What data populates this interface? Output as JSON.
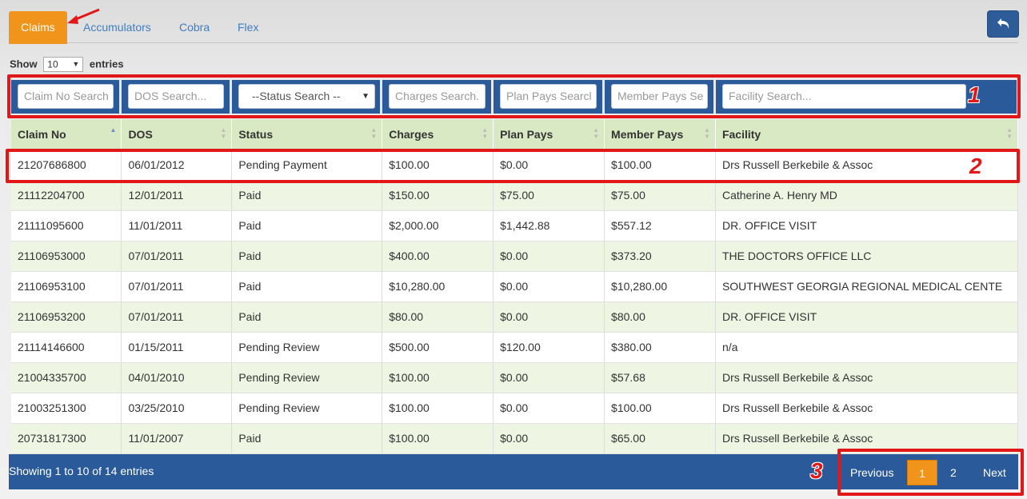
{
  "tabs": [
    {
      "label": "Claims",
      "active": true
    },
    {
      "label": "Accumulators"
    },
    {
      "label": "Cobra"
    },
    {
      "label": "Flex"
    }
  ],
  "show_entries": {
    "prefix": "Show",
    "value": "10",
    "suffix": "entries"
  },
  "filters": {
    "claim_no": "Claim No Search",
    "dos": "DOS Search...",
    "status": "--Status Search --",
    "charges": "Charges Search.",
    "plan_pays": "Plan Pays Searcl",
    "member_pays": "Member Pays Se",
    "facility": "Facility Search..."
  },
  "columns": [
    "Claim No",
    "DOS",
    "Status",
    "Charges",
    "Plan Pays",
    "Member Pays",
    "Facility"
  ],
  "rows": [
    [
      "21207686800",
      "06/01/2012",
      "Pending Payment",
      "$100.00",
      "$0.00",
      "$100.00",
      "Drs Russell Berkebile & Assoc"
    ],
    [
      "21112204700",
      "12/01/2011",
      "Paid",
      "$150.00",
      "$75.00",
      "$75.00",
      "Catherine A. Henry MD"
    ],
    [
      "21111095600",
      "11/01/2011",
      "Paid",
      "$2,000.00",
      "$1,442.88",
      "$557.12",
      "DR. OFFICE VISIT"
    ],
    [
      "21106953000",
      "07/01/2011",
      "Paid",
      "$400.00",
      "$0.00",
      "$373.20",
      "THE DOCTORS OFFICE LLC"
    ],
    [
      "21106953100",
      "07/01/2011",
      "Paid",
      "$10,280.00",
      "$0.00",
      "$10,280.00",
      "SOUTHWEST GEORGIA REGIONAL MEDICAL CENTE"
    ],
    [
      "21106953200",
      "07/01/2011",
      "Paid",
      "$80.00",
      "$0.00",
      "$80.00",
      "DR. OFFICE VISIT"
    ],
    [
      "21114146600",
      "01/15/2011",
      "Pending Review",
      "$500.00",
      "$120.00",
      "$380.00",
      "n/a"
    ],
    [
      "21004335700",
      "04/01/2010",
      "Pending Review",
      "$100.00",
      "$0.00",
      "$57.68",
      "Drs Russell Berkebile & Assoc"
    ],
    [
      "21003251300",
      "03/25/2010",
      "Pending Review",
      "$100.00",
      "$0.00",
      "$100.00",
      "Drs Russell Berkebile & Assoc"
    ],
    [
      "20731817300",
      "11/01/2007",
      "Paid",
      "$100.00",
      "$0.00",
      "$65.00",
      "Drs Russell Berkebile & Assoc"
    ]
  ],
  "footer": {
    "info": "Showing 1 to 10 of 14 entries",
    "previous": "Previous",
    "pages": [
      "1",
      "2"
    ],
    "next": "Next"
  },
  "annotations": [
    "1",
    "2",
    "3"
  ],
  "colors": {
    "accent_orange": "#f0941b",
    "header_blue": "#2a5a9a",
    "annotation_red": "#e21818",
    "table_header_green": "#d9e9c3"
  }
}
